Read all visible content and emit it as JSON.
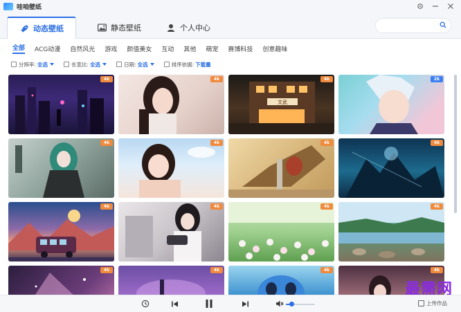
{
  "app": {
    "title": "哇咱壁纸"
  },
  "tabs": [
    {
      "label": "动态壁纸",
      "icon": "rocket-icon",
      "active": true
    },
    {
      "label": "静态壁纸",
      "icon": "image-icon",
      "active": false
    },
    {
      "label": "个人中心",
      "icon": "user-icon",
      "active": false
    }
  ],
  "search": {
    "placeholder": ""
  },
  "categories": [
    "全部",
    "ACG动漫",
    "自然风光",
    "游戏",
    "颜值美女",
    "互动",
    "其他",
    "萌宠",
    "赛博科技",
    "创意趣味"
  ],
  "filters": [
    {
      "label": "分辨率:",
      "value": "全选",
      "icon": "resolution-icon"
    },
    {
      "label": "长宽比:",
      "value": "全选",
      "icon": "aspect-ratio-icon"
    },
    {
      "label": "日期:",
      "value": "全选",
      "icon": "calendar-icon"
    },
    {
      "label": "排序依据:",
      "value": "下载量",
      "icon": "sort-icon"
    }
  ],
  "wallpapers": [
    {
      "badge": "4k"
    },
    {
      "badge": "4k"
    },
    {
      "badge": "4k"
    },
    {
      "badge": "2k"
    },
    {
      "badge": "4k"
    },
    {
      "badge": "4k"
    },
    {
      "badge": "4k"
    },
    {
      "badge": "4k"
    },
    {
      "badge": "4k"
    },
    {
      "badge": "4k"
    },
    {
      "badge": "4k"
    },
    {
      "badge": "4k"
    },
    {
      "badge": "4k"
    },
    {
      "badge": "4k"
    },
    {
      "badge": "4k"
    },
    {
      "badge": "4k"
    }
  ],
  "shop_sign": "文武",
  "player": {
    "volume_level": 0.2,
    "upload_label": "上传作品"
  },
  "watermark": "最需网",
  "colors": {
    "accent": "#2b6fe3",
    "badge_4k": "#f08a3c",
    "badge_2k": "#3c7ff0",
    "watermark": "#8a2be2"
  }
}
